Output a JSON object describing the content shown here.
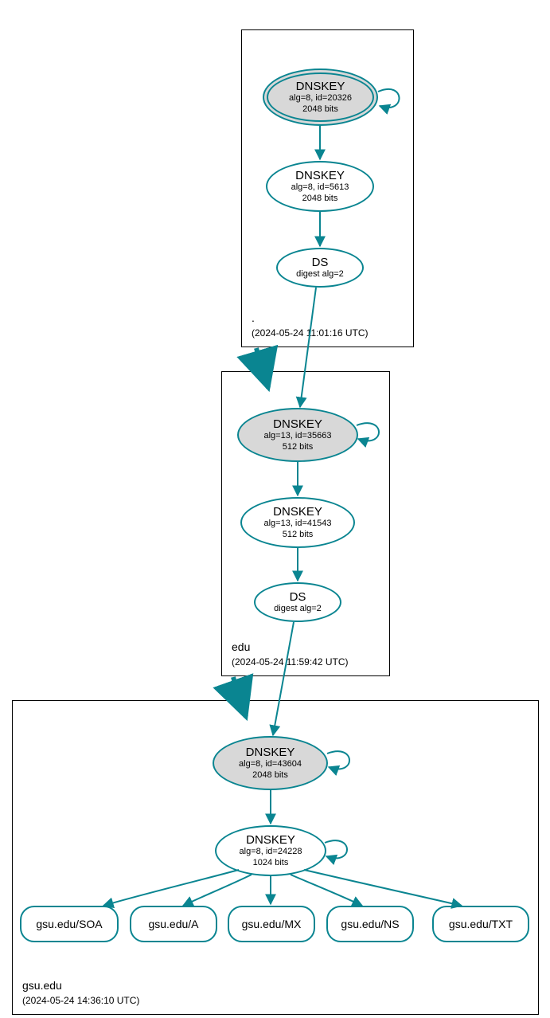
{
  "chart_data": {
    "type": "dnssec-chain",
    "zones": [
      {
        "name": ".",
        "timestamp": "(2024-05-24 11:01:16 UTC)",
        "nodes": [
          {
            "id": "root-ksk",
            "type": "DNSKEY",
            "alg": "alg=8, id=20326",
            "bits": "2048 bits",
            "ksk": true,
            "self_sign": true
          },
          {
            "id": "root-zsk",
            "type": "DNSKEY",
            "alg": "alg=8, id=5613",
            "bits": "2048 bits"
          },
          {
            "id": "root-ds",
            "type": "DS",
            "alg": "digest alg=2"
          }
        ]
      },
      {
        "name": "edu",
        "timestamp": "(2024-05-24 11:59:42 UTC)",
        "nodes": [
          {
            "id": "edu-ksk",
            "type": "DNSKEY",
            "alg": "alg=13, id=35663",
            "bits": "512 bits",
            "ksk": true,
            "self_sign": true
          },
          {
            "id": "edu-zsk",
            "type": "DNSKEY",
            "alg": "alg=13, id=41543",
            "bits": "512 bits"
          },
          {
            "id": "edu-ds",
            "type": "DS",
            "alg": "digest alg=2"
          }
        ]
      },
      {
        "name": "gsu.edu",
        "timestamp": "(2024-05-24 14:36:10 UTC)",
        "nodes": [
          {
            "id": "gsu-ksk",
            "type": "DNSKEY",
            "alg": "alg=8, id=43604",
            "bits": "2048 bits",
            "ksk": true,
            "self_sign": true
          },
          {
            "id": "gsu-zsk",
            "type": "DNSKEY",
            "alg": "alg=8, id=24228",
            "bits": "1024 bits",
            "self_sign": true
          }
        ],
        "rrsets": [
          "gsu.edu/SOA",
          "gsu.edu/A",
          "gsu.edu/MX",
          "gsu.edu/NS",
          "gsu.edu/TXT"
        ]
      }
    ],
    "edges": [
      [
        "root-ksk",
        "root-ksk"
      ],
      [
        "root-ksk",
        "root-zsk"
      ],
      [
        "root-zsk",
        "root-ds"
      ],
      [
        "root-ds",
        "edu-ksk"
      ],
      [
        "edu-ksk",
        "edu-ksk"
      ],
      [
        "edu-ksk",
        "edu-zsk"
      ],
      [
        "edu-zsk",
        "edu-ds"
      ],
      [
        "edu-ds",
        "gsu-ksk"
      ],
      [
        "gsu-ksk",
        "gsu-ksk"
      ],
      [
        "gsu-ksk",
        "gsu-zsk"
      ],
      [
        "gsu-zsk",
        "gsu-zsk"
      ],
      [
        "gsu-zsk",
        "gsu.edu/SOA"
      ],
      [
        "gsu-zsk",
        "gsu.edu/A"
      ],
      [
        "gsu-zsk",
        "gsu.edu/MX"
      ],
      [
        "gsu-zsk",
        "gsu.edu/NS"
      ],
      [
        "gsu-zsk",
        "gsu.edu/TXT"
      ]
    ]
  },
  "zones": {
    "root": {
      "name": ".",
      "ts": "(2024-05-24 11:01:16 UTC)"
    },
    "edu": {
      "name": "edu",
      "ts": "(2024-05-24 11:59:42 UTC)"
    },
    "gsu": {
      "name": "gsu.edu",
      "ts": "(2024-05-24 14:36:10 UTC)"
    }
  },
  "nodes": {
    "root_ksk": {
      "title": "DNSKEY",
      "l1": "alg=8, id=20326",
      "l2": "2048 bits"
    },
    "root_zsk": {
      "title": "DNSKEY",
      "l1": "alg=8, id=5613",
      "l2": "2048 bits"
    },
    "root_ds": {
      "title": "DS",
      "l1": "digest alg=2"
    },
    "edu_ksk": {
      "title": "DNSKEY",
      "l1": "alg=13, id=35663",
      "l2": "512 bits"
    },
    "edu_zsk": {
      "title": "DNSKEY",
      "l1": "alg=13, id=41543",
      "l2": "512 bits"
    },
    "edu_ds": {
      "title": "DS",
      "l1": "digest alg=2"
    },
    "gsu_ksk": {
      "title": "DNSKEY",
      "l1": "alg=8, id=43604",
      "l2": "2048 bits"
    },
    "gsu_zsk": {
      "title": "DNSKEY",
      "l1": "alg=8, id=24228",
      "l2": "1024 bits"
    }
  },
  "rr": {
    "soa": "gsu.edu/SOA",
    "a": "gsu.edu/A",
    "mx": "gsu.edu/MX",
    "ns": "gsu.edu/NS",
    "txt": "gsu.edu/TXT"
  }
}
